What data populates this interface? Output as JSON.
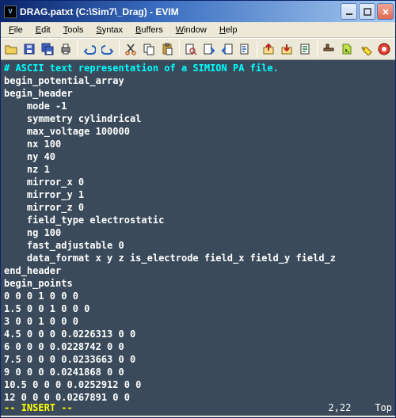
{
  "window": {
    "title": "DRAG.patxt (C:\\Sim7\\_Drag) - EVIM"
  },
  "menu": {
    "file": "File",
    "edit": "Edit",
    "tools": "Tools",
    "syntax": "Syntax",
    "buffers": "Buffers",
    "window": "Window",
    "help": "Help"
  },
  "editor": {
    "comment": "# ASCII text representation of a SIMION PA file.",
    "lines": [
      "begin_potential_array",
      "begin_header",
      "    mode -1",
      "    symmetry cylindrical",
      "    max_voltage 100000",
      "    nx 100",
      "    ny 40",
      "    nz 1",
      "    mirror_x 0",
      "    mirror_y 1",
      "    mirror_z 0",
      "    field_type electrostatic",
      "    ng 100",
      "    fast_adjustable 0",
      "    data_format x y z is_electrode field_x field_y field_z",
      "end_header",
      "begin_points",
      "0 0 0 1 0 0 0",
      "1.5 0 0 1 0 0 0",
      "3 0 0 1 0 0 0",
      "4.5 0 0 0 0.0226313 0 0",
      "6 0 0 0 0.0228742 0 0",
      "7.5 0 0 0 0.0233663 0 0",
      "9 0 0 0 0.0241868 0 0",
      "10.5 0 0 0 0.0252912 0 0",
      "12 0 0 0 0.0267891 0 0"
    ]
  },
  "status": {
    "dash1": "-- ",
    "mode": "INSERT",
    "dash2": " --",
    "position": "2,22",
    "scroll": "Top"
  }
}
